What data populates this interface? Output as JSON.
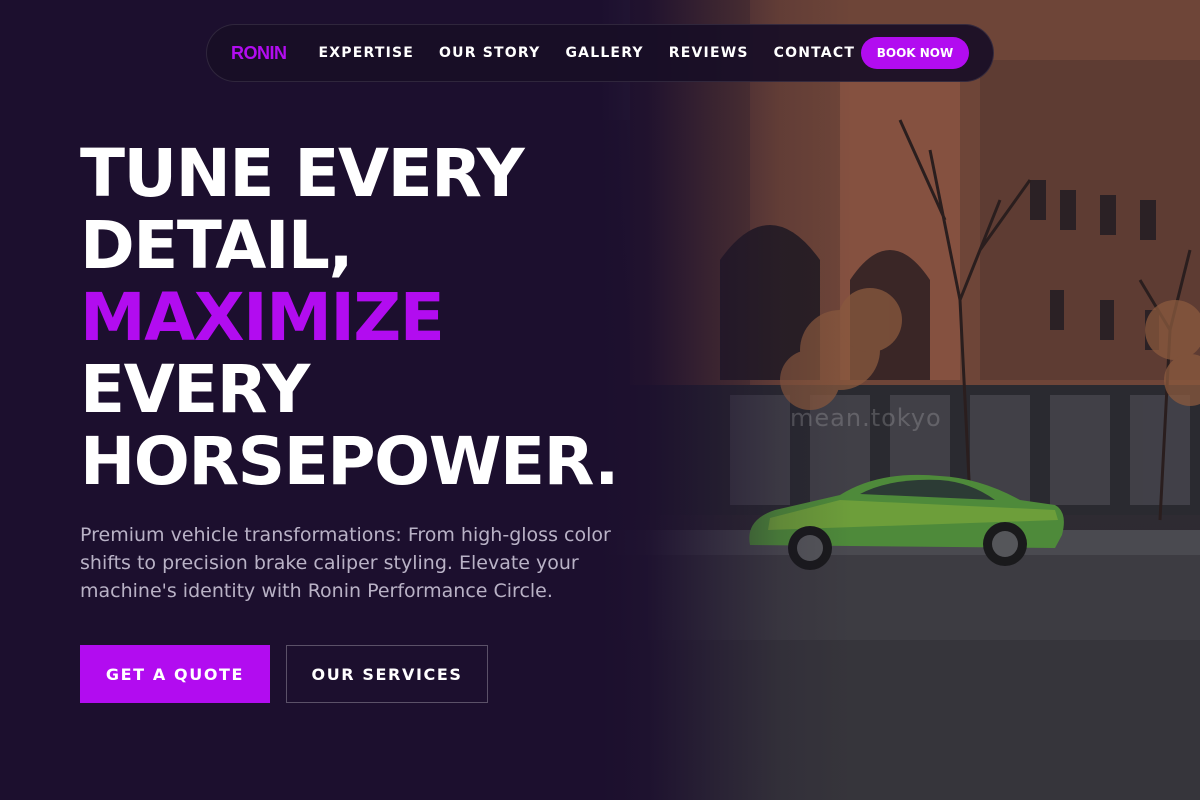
{
  "nav": {
    "logo": "RONIN",
    "links": [
      {
        "label": "EXPERTISE"
      },
      {
        "label": "OUR STORY"
      },
      {
        "label": "GALLERY"
      },
      {
        "label": "REVIEWS"
      },
      {
        "label": "CONTACT"
      }
    ],
    "book_label": "BOOK NOW"
  },
  "hero": {
    "headline": {
      "line1": "TUNE EVERY",
      "line2": "DETAIL,",
      "line3_accent": "MAXIMIZE",
      "line4": "EVERY",
      "line5": "HORSEPOWER."
    },
    "subtext": "Premium vehicle transformations: From high-gloss color shifts to precision brake caliper styling. Elevate your machine's identity with Ronin Performance Circle.",
    "cta_primary": "GET A QUOTE",
    "cta_secondary": "OUR SERVICES",
    "photo_watermark": "mean.tokyo"
  },
  "colors": {
    "accent": "#b20cf0",
    "background": "#1c0f2e",
    "text": "#ffffff",
    "muted_text": "#b9b2c6"
  }
}
